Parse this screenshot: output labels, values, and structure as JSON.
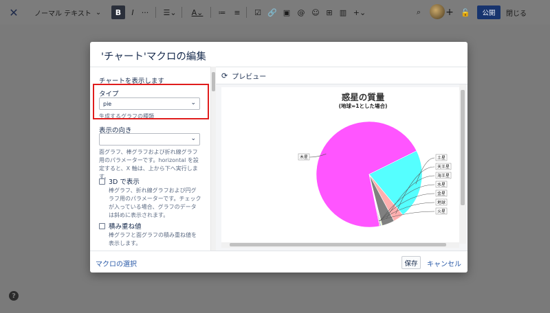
{
  "toolbar": {
    "text_style": "ノーマル テキスト",
    "bold": "B",
    "italic": "I",
    "more": "···",
    "publish": "公開",
    "close": "閉じる"
  },
  "dialog": {
    "title": "'チャート'マクロの編集",
    "show_chart": "チャートを表示します",
    "type_label": "タイプ",
    "type_value": "pie",
    "type_hint": "生成するグラフの種類",
    "orientation_label": "表示の向き",
    "orientation_value": "",
    "orientation_hint": "面グラフ、棒グラフおよび折れ線グラフ用のパラメーターです。horizontal を設定すると、X 軸は、上から下へ実行します。",
    "three_d_label": "3D で表示",
    "three_d_hint": "棒グラフ、折れ線グラフおよび円グラフ用のパラメーターです。チェックが入っている場合、グラフのデータは斜めに表示されます。",
    "stacked_label": "積み重ね値",
    "stacked_hint": "棒グラフと面グラフの積み重ね値を表示します。",
    "preview_label": "プレビュー",
    "macro_select": "マクロの選択",
    "save": "保存",
    "cancel": "キャンセル"
  },
  "chart_data": {
    "type": "pie",
    "title": "惑星の質量",
    "subtitle": "(地球=1とした場合)",
    "categories": [
      "木星",
      "土星",
      "天王星",
      "海王星",
      "水星",
      "金星",
      "地球",
      "火星"
    ],
    "values": [
      317.8,
      95.2,
      14.5,
      17.1,
      0.055,
      0.815,
      1,
      0.107
    ],
    "colors": [
      "#ff55ff",
      "#55ffff",
      "#ffafaf",
      "#808080",
      "#ffff55",
      "#55ff55",
      "#5555ff",
      "#ff5555"
    ]
  }
}
